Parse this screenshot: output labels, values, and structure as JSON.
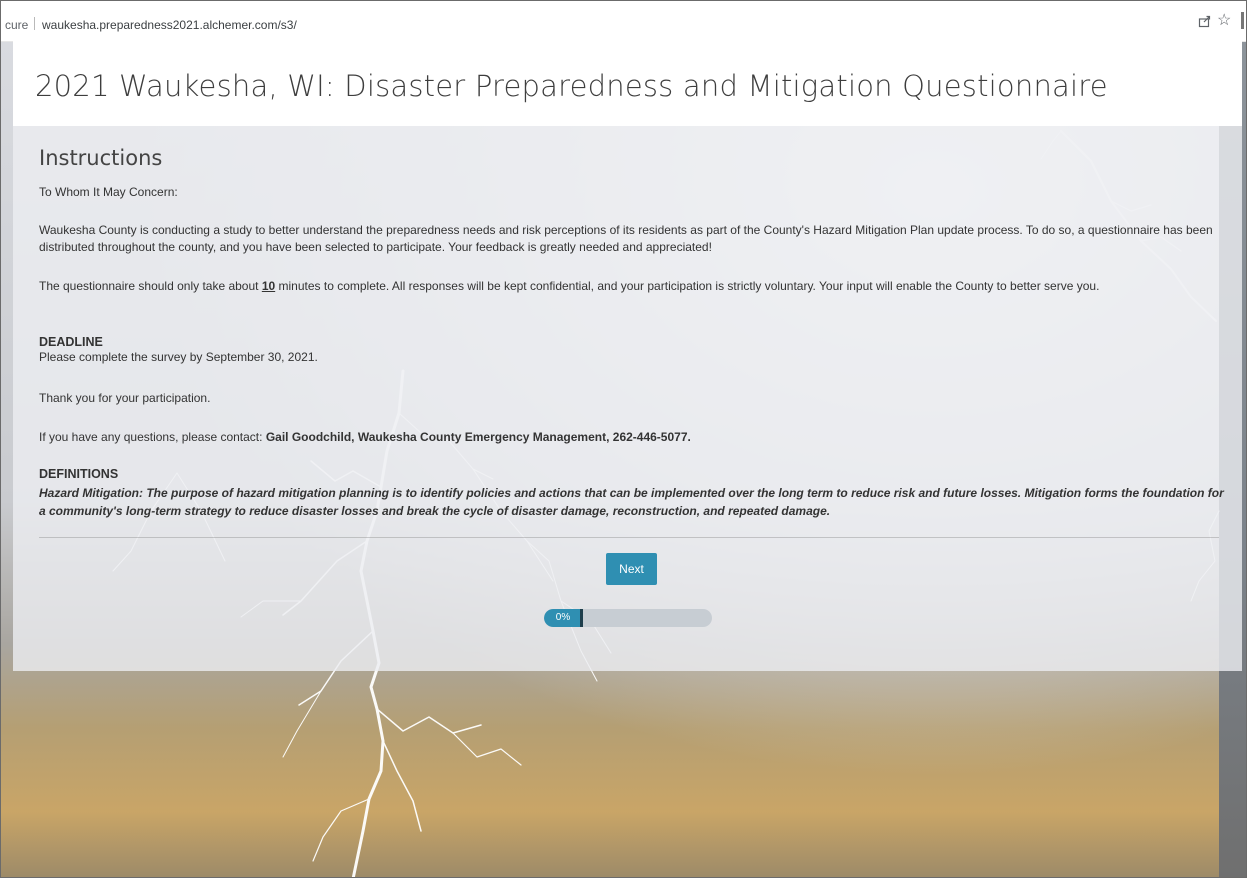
{
  "browser": {
    "security_label": "cure",
    "url": "waukesha.preparedness2021.alchemer.com/s3/",
    "share_icon": "share-icon",
    "bookmark_icon": "star-icon"
  },
  "survey": {
    "title": "2021 Waukesha, WI: Disaster Preparedness and Mitigation Questionnaire",
    "section_title": "Instructions",
    "salutation": "To Whom It May Concern:",
    "intro": "Waukesha County is conducting a study to better understand the preparedness needs and risk perceptions of its residents as part of the County's Hazard Mitigation Plan update process. To do so, a questionnaire has been distributed throughout the county, and you have been selected to participate. Your feedback is greatly needed and appreciated!",
    "duration_before": "The questionnaire should only take about ",
    "duration_value": "10",
    "duration_after": " minutes to complete. All responses will be kept confidential, and your participation is strictly voluntary. Your input will enable the County to better serve you.",
    "deadline_heading": "DEADLINE",
    "deadline_text": "Please complete the survey by September 30, 2021.",
    "thanks": "Thank you for your participation.",
    "contact_prefix": "If you have any questions, please contact:  ",
    "contact_details": "Gail Goodchild, Waukesha County Emergency Management, 262-446-5077.",
    "definitions_heading": "DEFINITIONS",
    "definition_text": "Hazard Mitigation:  The purpose of hazard mitigation planning is to identify policies and actions that can be implemented over the long term to reduce risk and future losses. Mitigation forms the foundation for a community's long-term strategy to reduce disaster losses and break the cycle of disaster damage, reconstruction, and repeated damage.",
    "next_label": "Next",
    "progress_label": "0%",
    "progress_value": 0
  },
  "colors": {
    "accent": "#2f8fb2",
    "progress_track": "#c7cdd3",
    "title_text": "#3e3e3e"
  }
}
